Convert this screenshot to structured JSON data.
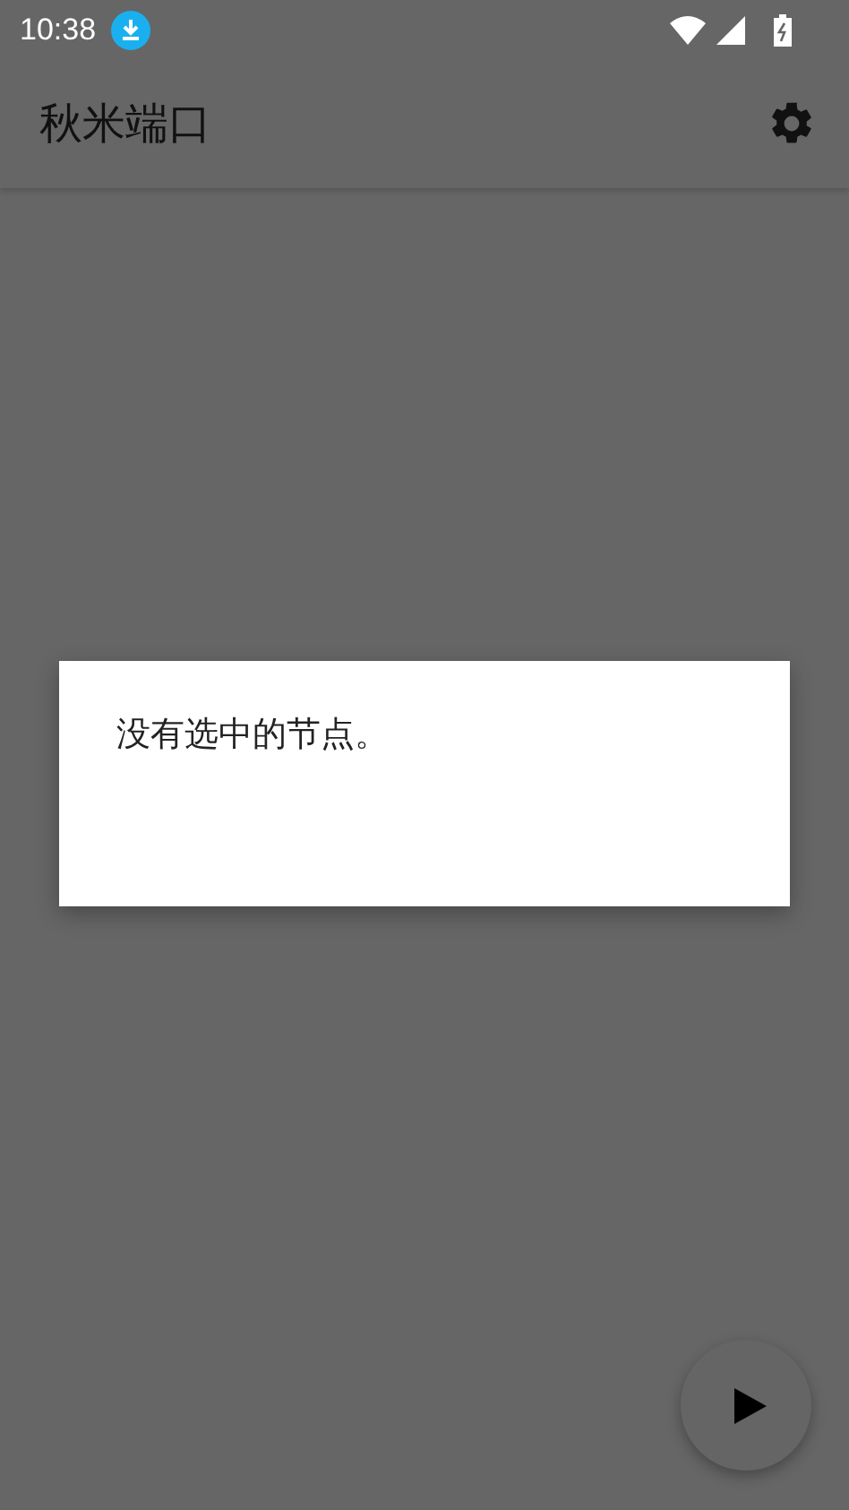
{
  "status_bar": {
    "time": "10:38"
  },
  "app_bar": {
    "title": "秋米端口"
  },
  "dialog": {
    "message": "没有选中的节点。"
  }
}
